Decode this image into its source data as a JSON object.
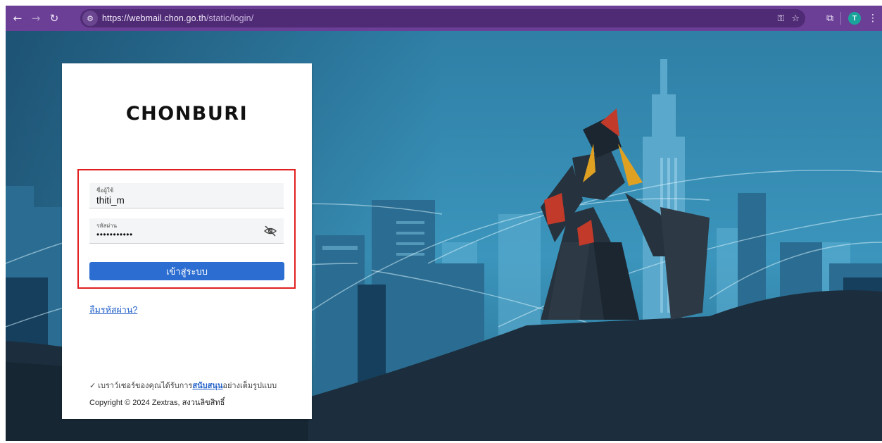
{
  "browser": {
    "url_host": "https://webmail.chon.go.th",
    "url_path": "/static/login/",
    "profile_initial": "T",
    "icons": {
      "back": "arrow-left-icon",
      "forward": "arrow-right-icon",
      "reload": "reload-icon",
      "site_info": "tune-icon",
      "password_key": "key-icon",
      "bookmark": "star-icon",
      "extensions": "puzzle-icon",
      "menu": "kebab-menu-icon"
    },
    "theme_color": "#6c3f97"
  },
  "login": {
    "brand": "CHONBURI",
    "username_label": "ชื่อผู้ใช้",
    "username_value": "thiti_m",
    "password_label": "รหัสผ่าน",
    "password_value": "•••••••••••",
    "submit_label": "เข้าสู่ระบบ",
    "forgot_label": "ลืมรหัสผ่าน?",
    "support_prefix": "✓ เบราว์เซอร์ของคุณได้รับการ",
    "support_link": "สนับสนุน",
    "support_suffix": "อย่างเต็มรูปแบบ",
    "copyright": "Copyright © 2024 Zextras, สงวนลิขสิทธิ์",
    "accent_color": "#2b6dd1",
    "highlight_color": "#e21f1f"
  }
}
